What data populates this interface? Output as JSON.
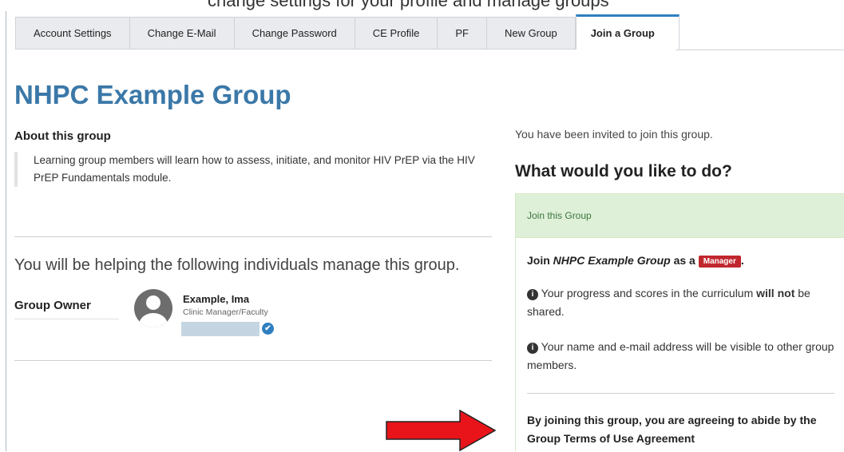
{
  "top_fragment": "change settings for your profile and manage groups",
  "tabs": [
    {
      "label": "Account Settings"
    },
    {
      "label": "Change E-Mail"
    },
    {
      "label": "Change Password"
    },
    {
      "label": "CE Profile"
    },
    {
      "label": "PF"
    },
    {
      "label": "New Group"
    },
    {
      "label": "Join a Group",
      "active": true
    }
  ],
  "group": {
    "title": "NHPC Example Group",
    "about_heading": "About this group",
    "about_text": "Learning group members will learn how to assess, initiate, and monitor HIV PrEP via the HIV PrEP Fundamentals module.",
    "helping_text": "You will be helping the following individuals manage this group.",
    "owner_label": "Group Owner",
    "owner": {
      "name": "Example, Ima",
      "role": "Clinic Manager/Faculty",
      "verified_icon": "check-circle-icon"
    }
  },
  "invite": {
    "status_text": "You have been invited to join this group.",
    "question": "What would you like to do?",
    "panel_header": "Join this Group",
    "join_prefix": "Join ",
    "join_group": "NHPC Example Group",
    "join_as": " as a ",
    "role_badge": "Manager",
    "join_suffix": ".",
    "note1_before": " Your progress and scores in the curriculum ",
    "note1_strong": "will not",
    "note1_after": " be shared.",
    "note2": " Your name and e-mail address will be visible to other group members.",
    "terms": "By joining this group, you are agreeing to abide by the Group Terms of Use Agreement"
  },
  "colors": {
    "title": "#3b78a8",
    "active_tab_accent": "#2f7fc0",
    "panel_header_bg": "#dff0d8",
    "badge_bg": "#c0272d",
    "annotation_arrow": "#e8141a"
  }
}
